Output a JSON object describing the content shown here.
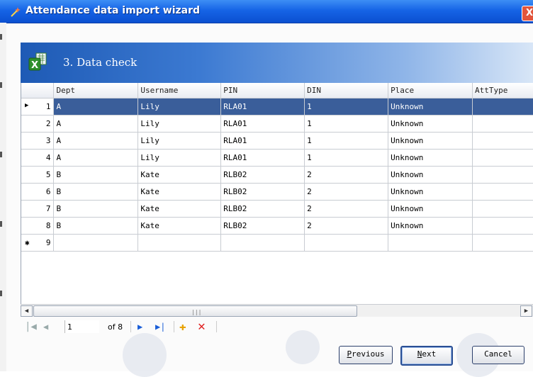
{
  "window": {
    "title": "Attendance data import wizard",
    "close_label": "X"
  },
  "step": {
    "label": "3. Data check"
  },
  "grid": {
    "columns": [
      "Dept",
      "Username",
      "PIN",
      "DIN",
      "Place",
      "AttType"
    ],
    "rows": [
      {
        "index": "1",
        "cells": [
          "A",
          "Lily",
          "RLA01",
          "1",
          "Unknown",
          ""
        ]
      },
      {
        "index": "2",
        "cells": [
          "A",
          "Lily",
          "RLA01",
          "1",
          "Unknown",
          ""
        ]
      },
      {
        "index": "3",
        "cells": [
          "A",
          "Lily",
          "RLA01",
          "1",
          "Unknown",
          ""
        ]
      },
      {
        "index": "4",
        "cells": [
          "A",
          "Lily",
          "RLA01",
          "1",
          "Unknown",
          ""
        ]
      },
      {
        "index": "5",
        "cells": [
          "B",
          "Kate",
          "RLB02",
          "2",
          "Unknown",
          ""
        ]
      },
      {
        "index": "6",
        "cells": [
          "B",
          "Kate",
          "RLB02",
          "2",
          "Unknown",
          ""
        ]
      },
      {
        "index": "7",
        "cells": [
          "B",
          "Kate",
          "RLB02",
          "2",
          "Unknown",
          ""
        ]
      },
      {
        "index": "8",
        "cells": [
          "B",
          "Kate",
          "RLB02",
          "2",
          "Unknown",
          ""
        ]
      },
      {
        "index": "9",
        "cells": [
          "",
          "",
          "",
          "",
          "",
          ""
        ]
      }
    ],
    "selected_marker": "▶",
    "new_row_marker": "✱"
  },
  "navigator": {
    "position": "1",
    "of_label": "of 8",
    "first_glyph": "|◀",
    "prev_glyph": "◀",
    "next_glyph": "▶",
    "last_glyph": "▶|",
    "add_glyph": "✚",
    "delete_glyph": "✕"
  },
  "buttons": {
    "previous": "Previous",
    "previous_accel": "P",
    "previous_rest": "revious",
    "next_accel": "N",
    "next_rest": "ext",
    "cancel": "Cancel"
  },
  "colors": {
    "title_bar": "#1664e6",
    "selection": "#3a5e9a",
    "nav_blue": "#1b5fd8",
    "nav_add": "#e8a200",
    "nav_delete": "#e02020"
  }
}
